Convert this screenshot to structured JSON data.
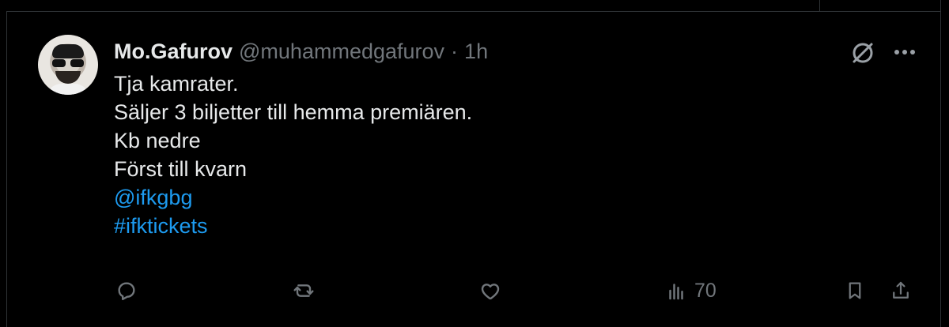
{
  "tweet": {
    "author": {
      "display_name": "Mo.Gafurov",
      "handle": "@muhammedgafurov",
      "separator": "·",
      "time": "1h",
      "avatar_icon": "avatar"
    },
    "text_lines": [
      "Tja kamrater.",
      "Säljer 3 biljetter till hemma premiären.",
      "Kb nedre",
      "Först till kvarn"
    ],
    "mention": "@ifkgbg",
    "hashtag": "#ifktickets",
    "actions": {
      "reply_icon": "reply-icon",
      "retweet_icon": "retweet-icon",
      "like_icon": "heart-icon",
      "views_icon": "views-icon",
      "views_count": "70",
      "bookmark_icon": "bookmark-icon",
      "share_icon": "share-icon"
    },
    "top_right_icons": [
      "grok-icon",
      "more-icon"
    ]
  },
  "colors": {
    "background": "#000000",
    "primary_text": "#e7e9ea",
    "secondary_text": "#71767b",
    "link": "#1d9bf0",
    "border": "#2f3336"
  }
}
